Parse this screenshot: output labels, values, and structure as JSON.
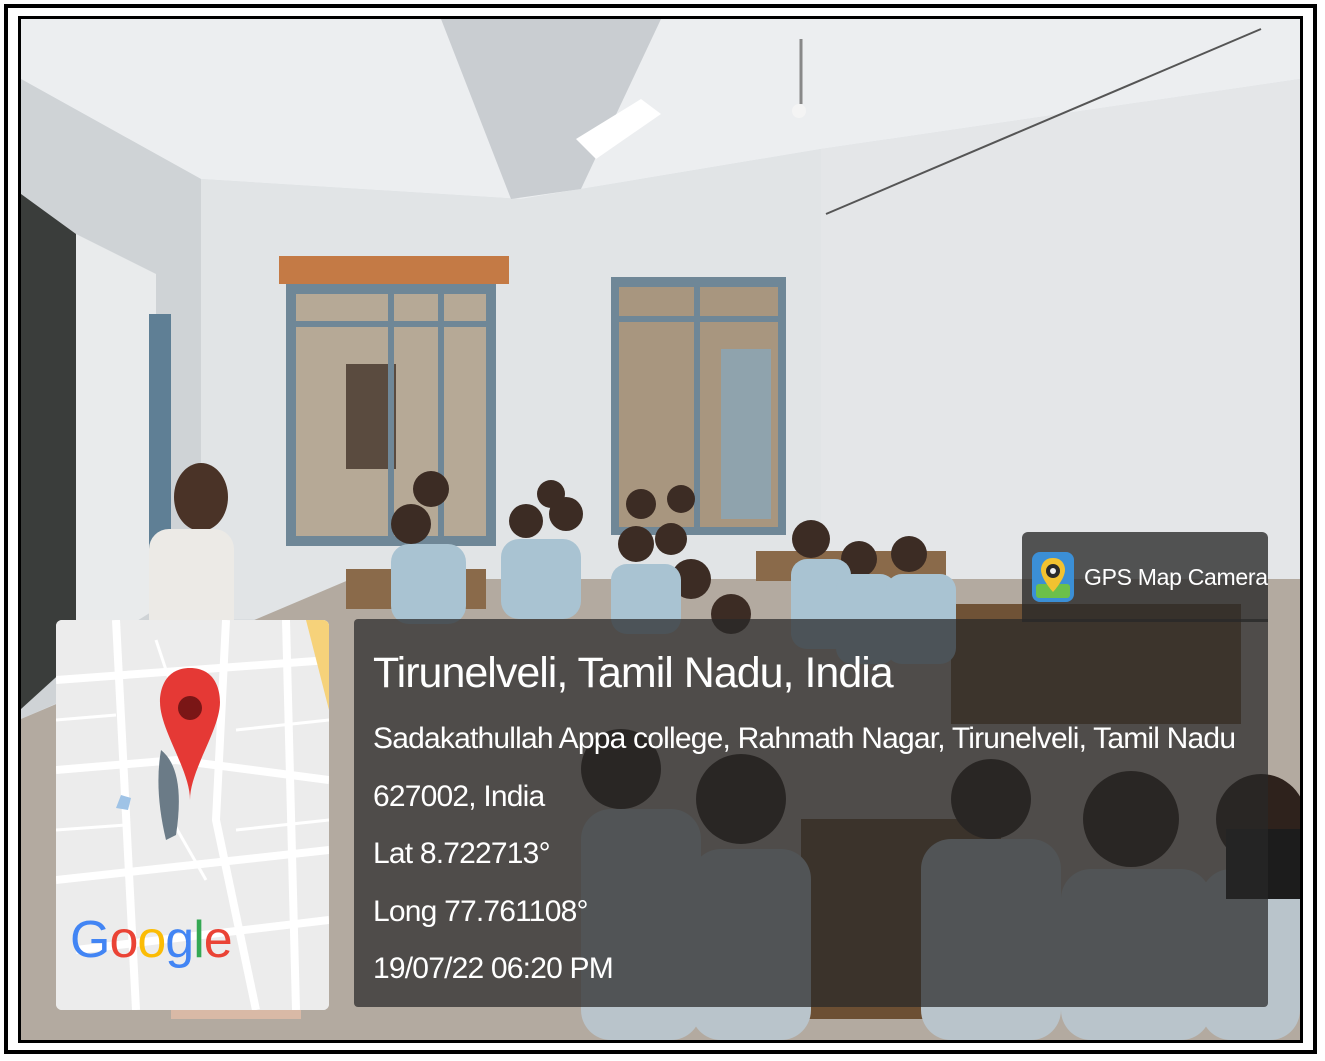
{
  "badge": {
    "app_name": "GPS Map Camera",
    "icon": "gps-map-camera-icon"
  },
  "location": {
    "title": "Tirunelveli, Tamil Nadu, India",
    "address_line1": "Sadakathullah Appa college, Rahmath Nagar, Tirunelveli, Tamil Nadu",
    "address_line2": "627002, India",
    "latitude": "Lat 8.722713°",
    "longitude": "Long 77.761108°",
    "datetime": "19/07/22 06:20 PM"
  },
  "map": {
    "logo_letters": [
      "G",
      "o",
      "o",
      "g",
      "l",
      "e"
    ],
    "logo_colors": [
      "#4285F4",
      "#EA4335",
      "#FBBC05",
      "#4285F4",
      "#34A853",
      "#EA4335"
    ],
    "pin_color": "#E53935"
  }
}
